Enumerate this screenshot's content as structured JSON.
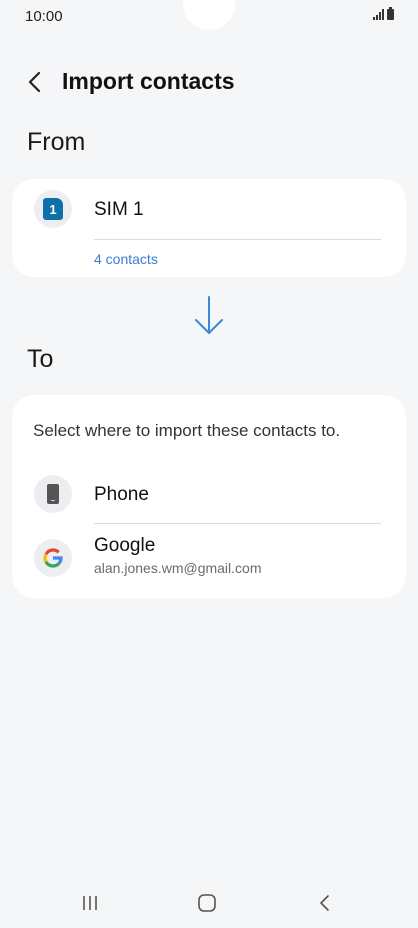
{
  "status_bar": {
    "time": "10:00"
  },
  "header": {
    "title": "Import contacts"
  },
  "from_section": {
    "label": "From",
    "source": {
      "name": "SIM 1",
      "badge": "1",
      "count_link": "4 contacts"
    }
  },
  "to_section": {
    "label": "To",
    "description": "Select where to import these contacts to.",
    "options": [
      {
        "name": "Phone"
      },
      {
        "name": "Google",
        "account": "alan.jones.wm@gmail.com"
      }
    ]
  },
  "icons": {
    "back": "chevron-left-icon",
    "sim": "sim-card-icon",
    "arrow": "arrow-down-icon",
    "phone": "phone-icon",
    "google": "google-logo-icon",
    "nav_recents": "recent-apps-icon",
    "nav_home": "home-icon",
    "nav_back": "back-icon"
  },
  "colors": {
    "background": "#f5f6f8",
    "card": "#ffffff",
    "accent": "#3a7bd5",
    "sim_blue": "#0f6fa8"
  }
}
